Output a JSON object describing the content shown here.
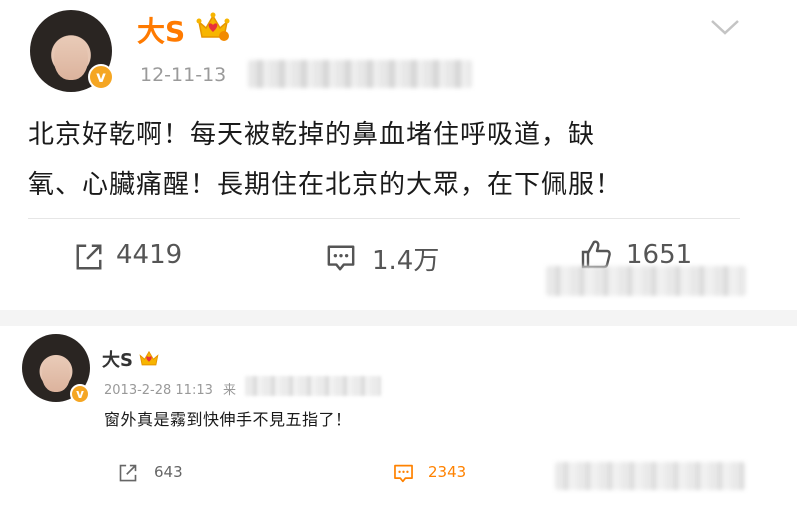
{
  "post": {
    "author": "大S",
    "timestamp": "12-11-13",
    "text": "北京好乾啊！每天被乾掉的鼻血堵住呼吸道，缺氧、心臟痛醒！長期住在北京的大眾，在下佩服！",
    "text_line1": "北京好乾啊！每天被乾掉的鼻血堵住呼吸道，缺",
    "text_line2": "氧、心臟痛醒！長期住在北京的大眾，在下佩服！",
    "reposts": "4419",
    "comments": "1.4万",
    "likes": "1651",
    "badge": "v"
  },
  "comment": {
    "author": "大S",
    "timestamp": "2013-2-28 11:13",
    "source_prefix": "来",
    "text": "窗外真是霧到快伸手不見五指了！",
    "reposts": "643",
    "comments": "2343",
    "badge": "v"
  },
  "icons": {
    "crown": "crown-icon",
    "verified": "verified-badge-icon",
    "repost": "repost-icon",
    "comment": "comment-icon",
    "like": "thumbs-up-icon",
    "more": "chevron-down-icon"
  },
  "colors": {
    "username": "#ff7a00",
    "verified": "#f5a623",
    "accent": "#ff8200"
  }
}
